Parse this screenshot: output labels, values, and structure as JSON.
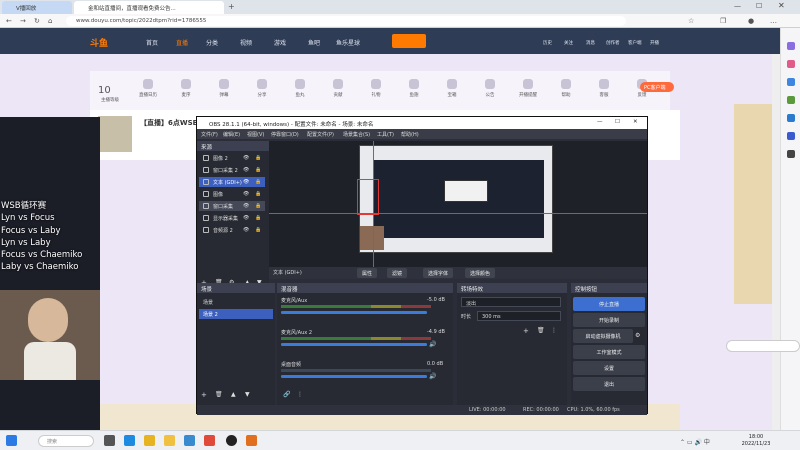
{
  "browser": {
    "tabs": [
      {
        "label": "V播回放"
      },
      {
        "label": "金和站直播间，直播观看免费公告..."
      }
    ],
    "url": "www.douyu.com/topic/2022dtpm?rid=1786555"
  },
  "site": {
    "logo": "斗鱼",
    "nav": [
      "首页",
      "直播",
      "分类",
      "视频",
      "游戏",
      "鱼吧",
      "鱼乐星球"
    ],
    "user_nav": [
      "历史",
      "关注",
      "消息",
      "创作者",
      "客户端",
      "开播"
    ],
    "icon_row": [
      "主播等级",
      "直播日历",
      "麦序",
      "弹幕",
      "分享",
      "鱼丸",
      "贡献",
      "礼物",
      "鱼翅",
      "宝箱",
      "公告",
      "开播提醒",
      "帮助",
      "客服",
      "反馈"
    ],
    "level_number": "10",
    "streamer_title": "【直播】6点WSB",
    "pc_button": "PC客户端"
  },
  "stream_overlay": {
    "lines": [
      "WSB循环赛",
      "Lyn vs Focus",
      "Focus vs Laby",
      "Lyn vs Laby",
      "Focus vs Chaemiko",
      "Laby vs Chaemiko"
    ]
  },
  "obs": {
    "title": "OBS 28.1.1 (64-bit, windows) - 配置文件: 未命名 - 场景: 未命名",
    "menu": [
      "文件(F)",
      "编辑(E)",
      "视图(V)",
      "停靠窗口(D)",
      "配置文件(P)",
      "场景集合(S)",
      "工具(T)",
      "帮助(H)"
    ],
    "sources_title": "来源",
    "sources": [
      {
        "label": "图像 2",
        "selected": false
      },
      {
        "label": "窗口采集 2",
        "selected": false
      },
      {
        "label": "文本 (GDI+)",
        "selected": true
      },
      {
        "label": "图像",
        "selected": false
      },
      {
        "label": "窗口采集",
        "selected": false
      },
      {
        "label": "显示器采集",
        "selected": false
      },
      {
        "label": "音频源 2",
        "selected": false
      }
    ],
    "toolbar": {
      "selected_source": "文本 (GDI+)",
      "properties": "属性",
      "filters": "滤镜",
      "font": "选择字体",
      "color": "选择颜色"
    },
    "scenes_title": "场景",
    "scenes": [
      {
        "label": "场景",
        "selected": false
      },
      {
        "label": "场景 2",
        "selected": true
      }
    ],
    "mixer_title": "混音器",
    "mixer": [
      {
        "name": "麦克风/Aux",
        "db": "-5.0 dB"
      },
      {
        "name": "麦克风/Aux 2",
        "db": "-4.9 dB"
      },
      {
        "name": "桌面音频",
        "db": "0.0 dB"
      }
    ],
    "transitions_title": "转场特效",
    "transition": "淡出",
    "duration_label": "时长",
    "duration": "300 ms",
    "controls_title": "控制按钮",
    "controls": [
      "停止直播",
      "开始录制",
      "启动虚拟摄像机",
      "工作室模式",
      "设置",
      "退出"
    ],
    "status": {
      "live": "LIVE: 00:00:00",
      "rec": "REC: 00:00:00",
      "cpu": "CPU: 1.0%, 60.00 fps"
    }
  },
  "taskbar": {
    "search_placeholder": "搜索",
    "time": "18:00",
    "date": "2022/11/23"
  }
}
